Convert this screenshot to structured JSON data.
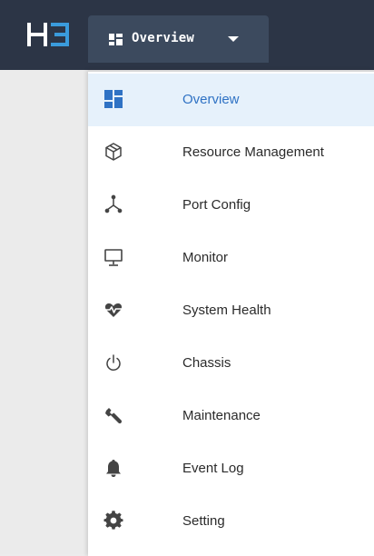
{
  "header": {
    "logo_text": "H3",
    "nav_button_label": "Overview",
    "nav_icon": "dashboard-grid-icon",
    "caret_icon": "caret-down-icon"
  },
  "colors": {
    "topbar": "#2c3546",
    "nav_button": "#3c4a5e",
    "accent": "#2f72c4",
    "logo_accent": "#3a9bdc",
    "active_bg": "#e6f1fb"
  },
  "menu": {
    "active_index": 0,
    "items": [
      {
        "label": "Overview",
        "icon": "dashboard-icon"
      },
      {
        "label": "Resource Management",
        "icon": "cube-icon"
      },
      {
        "label": "Port Config",
        "icon": "port-tree-icon"
      },
      {
        "label": "Monitor",
        "icon": "monitor-icon"
      },
      {
        "label": "System Health",
        "icon": "heartbeat-icon"
      },
      {
        "label": "Chassis",
        "icon": "power-icon"
      },
      {
        "label": "Maintenance",
        "icon": "wrench-icon"
      },
      {
        "label": "Event Log",
        "icon": "bell-icon"
      },
      {
        "label": "Setting",
        "icon": "gear-icon"
      }
    ]
  }
}
